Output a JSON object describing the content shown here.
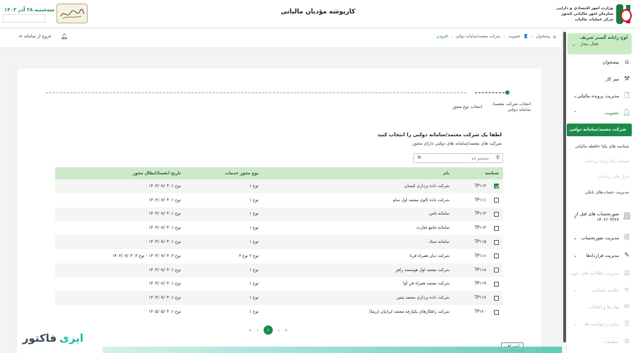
{
  "header": {
    "title": "کارپوشه مؤدیان مالیاتی",
    "gov_lines": [
      "وزارت امور اقتصادی و دارایی",
      "سازمان امور مالیاتی کشور",
      "مرکز عملیات مالیات"
    ],
    "date_text": "سه‌شنبه ۲۸ آذر ۱۴۰۳"
  },
  "sidebar": {
    "org_name": "اوج رایانه گستر شریف",
    "org_role": "فعال مجاز",
    "items": [
      {
        "label": "پیشخوان",
        "icon": "home-icon",
        "state": "normal",
        "expandable": false
      },
      {
        "label": "میز کار",
        "icon": "tools-icon",
        "state": "normal",
        "expandable": false
      },
      {
        "label": "مدیریت پرونده مالیاتی",
        "icon": "file-icon",
        "state": "normal",
        "expandable": true
      },
      {
        "label": "عضویت",
        "icon": "user-icon",
        "state": "green",
        "expandable": true
      }
    ],
    "subitems": [
      {
        "label": "شرکت معتمد/سامانه دولتی",
        "state": "active"
      },
      {
        "label": "شناسه های یکتا حافظه مالیاتی",
        "state": "normal"
      },
      {
        "label": "شناسه یکتا رایانه پرداخت",
        "state": "dim"
      },
      {
        "label": "ابزار های پرداخت",
        "state": "dim"
      },
      {
        "label": "مدیریت حساب‌های بانکی",
        "state": "normal"
      }
    ],
    "items2": [
      {
        "label": "صورتحساب های قبل از ۱۴۰۲/۰۳/۲۷",
        "icon": "receipt-icon",
        "state": "normal",
        "expandable": true
      },
      {
        "label": "مدیریت صورتحساب",
        "icon": "invoice-icon",
        "state": "normal",
        "expandable": true
      },
      {
        "label": "مدیریت قراردادها",
        "icon": "contract-icon",
        "state": "normal",
        "expandable": true
      },
      {
        "label": "مدیریت اطلاعیه های خرید",
        "icon": "notice-icon",
        "state": "dim",
        "expandable": true
      },
      {
        "label": "خلاصه عملکرد",
        "icon": "chart-icon",
        "state": "dim",
        "expandable": true
      },
      {
        "label": "پیام ها و اعلانات",
        "icon": "message-icon",
        "state": "dim",
        "expandable": false
      },
      {
        "label": "سایر درخواست ها",
        "icon": "request-icon",
        "state": "dim",
        "expandable": true
      },
      {
        "label": "تنظیمات",
        "icon": "gear-icon",
        "state": "dim",
        "expandable": false
      }
    ]
  },
  "breadcrumb": [
    "پیشخوان",
    "عضویت",
    "شرکت معتمد/سامانه دولتی",
    "افزودن"
  ],
  "toolbar": {
    "exit_label": "خروج از سامانه"
  },
  "steps": {
    "step1": "انتخاب شرکت معتمد/ سامانه دولتی",
    "step2": "انتخاب نوع مجوز"
  },
  "main": {
    "prompt": "لطفا یک شرکت معتمد/سامانه دولتی را انتخاب کنید",
    "subprompt": "شرکت های معتمد/سامانه های دولتی دارای مجوز:",
    "search_placeholder": "جستجو نام"
  },
  "table": {
    "headers": [
      "شناسه",
      "نام",
      "نوع مجوز خدمات",
      "تاریخ انقضا/ابطال مجوز"
    ],
    "rows": [
      {
        "id": "TP۱۱۳",
        "name": "شرکت داده پردازی کیسان",
        "type": "نوع ۱",
        "expiry": "نوع ۱: ۱۴۰۳/۰۷/۰۴",
        "checked": true
      },
      {
        "id": "TP۱۱۱",
        "name": "شرکت داده کاوی معتمد اول سام",
        "type": "نوع ۱",
        "expiry": "نوع ۱: ۱۴۰۳/۰۷/۰۴",
        "checked": false
      },
      {
        "id": "TP۱۱۳",
        "name": "سامانه تامن",
        "type": "نوع ۱",
        "expiry": "نوع ۱: ۱۴۰۳/۰۷/۰۴",
        "checked": false
      },
      {
        "id": "TP۱۱۴",
        "name": "سامانه جامع تجارت",
        "type": "نوع ۱",
        "expiry": "نوع ۱: ۱۴۰۳/۰۷/۰۴",
        "checked": false
      },
      {
        "id": "TP۱۱۵",
        "name": "سامانه ستاد",
        "type": "نوع ۱",
        "expiry": "نوع ۱: ۱۴۰۳/۰۷/۰۴",
        "checked": false
      },
      {
        "id": "TP۱۱۶",
        "name": "شرکت دیان همراه فردا",
        "type": "نوع ۲  نوع ۳",
        "expiry": "نوع ۲: ۱۴۰۳/۰۷/۰۴  -  نوع ۳: ۱۴۰۳/۰۷/۰۴",
        "checked": false
      },
      {
        "id": "TP۱۱۸",
        "name": "شرکت معتمد اول هوشمند زاهر",
        "type": "نوع ۱",
        "expiry": "نوع ۱: ۱۴۰۳/۰۷/۰۴",
        "checked": false
      },
      {
        "id": "TP۱۱۹",
        "name": "شرکت معتمد همراه فن آوا",
        "type": "نوع ۱",
        "expiry": "نوع ۱: ۱۴۰۳/۰۷/۰۴",
        "checked": false
      },
      {
        "id": "TP۱۱۷",
        "name": "شرکت داده پردازی معتمد تیس",
        "type": "نوع ۱",
        "expiry": "نوع ۱: ۱۴۰۳/۰۷/۰۴",
        "checked": false
      },
      {
        "id": "TP۱۲۰",
        "name": "شرکت راهکارهای یکپارچه معتمد ایرانیان (ریما)",
        "type": "نوع ۱",
        "expiry": "نوع ۱: ۱۴۰۵/۰۵/۰۴",
        "checked": false
      }
    ]
  },
  "pagination": {
    "current": "۱"
  },
  "footer": {
    "cancel_label": "انصراف",
    "brand_part1": "فاکتور",
    "brand_part2": "ایزی"
  },
  "colors": {
    "accent": "#1e8a4a",
    "header_row": "#cfe8cc",
    "brand_teal": "#1eb8a0"
  }
}
